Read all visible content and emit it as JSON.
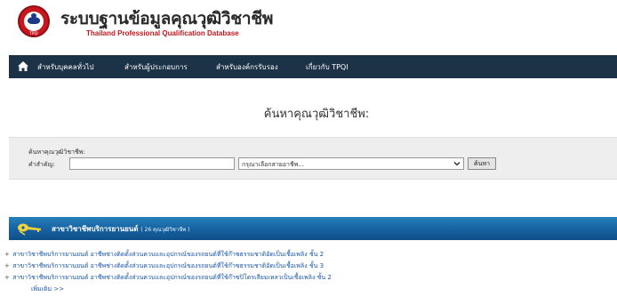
{
  "header": {
    "title_th": "ระบบฐานข้อมูลคุณวุฒิวิชาชีพ",
    "title_en": "Thailand Professional Qualification Database",
    "logo_text": "TPQI"
  },
  "nav": {
    "items": [
      {
        "label": "สำหรับบุคคลทั่วไป"
      },
      {
        "label": "สำหรับผู้ประกอบการ"
      },
      {
        "label": "สำหรับองค์กรรับรอง"
      },
      {
        "label": "เกี่ยวกับ TPQI"
      }
    ]
  },
  "search": {
    "heading": "ค้นหาคุณวุฒิวิชาชีพ:",
    "legend": "ค้นหาคุณวุฒิวิชาชีพ:",
    "keyword_label": "คำสำคัญ:",
    "keyword_value": "",
    "sector_selected": "กรุณาเลือกสายอาชีพ...",
    "button_label": "ค้นหา"
  },
  "category": {
    "title": "สาขาวิชาชีพบริการยานยนต์",
    "count": "( 26 คุณวุฒิวิชาชีพ )"
  },
  "occupations": [
    {
      "label": "สาขาวิชาชีพบริการยานยนต์ อาชีพช่างติดตั้งส่วนควบและอุปกรณ์ของรถยนต์ที่ใช้ก๊าซธรรมชาติอัดเป็นเชื้อเพลิง ชั้น 2"
    },
    {
      "label": "สาขาวิชาชีพบริการยานยนต์ อาชีพช่างติดตั้งส่วนควบและอุปกรณ์ของรถยนต์ที่ใช้ก๊าซธรรมชาติอัดเป็นเชื้อเพลิง ชั้น 3"
    },
    {
      "label": "สาขาวิชาชีพบริการยานยนต์ อาชีพช่างติดตั้งส่วนควบและอุปกรณ์ของรถยนต์ที่ใช้ก๊าซปิโตรเลียมเหลวเป็นเชื้อเพลิง ชั้น 2"
    }
  ],
  "more_label": "เพิ่มเติม >>",
  "colors": {
    "nav_bg": "#1c3247",
    "banner_blue": "#1661a0",
    "link_blue": "#1a56a8",
    "brand_red": "#c8161d"
  },
  "icons": {
    "home": "home-icon",
    "category": "car-key-icon",
    "logo": "tpqi-logo"
  }
}
